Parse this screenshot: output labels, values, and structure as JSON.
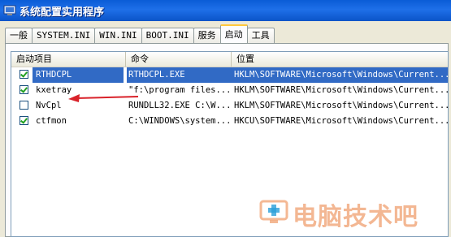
{
  "window": {
    "title": "系统配置实用程序"
  },
  "tabs": [
    {
      "label": "一般"
    },
    {
      "label": "SYSTEM.INI"
    },
    {
      "label": "WIN.INI"
    },
    {
      "label": "BOOT.INI"
    },
    {
      "label": "服务"
    },
    {
      "label": "启动",
      "active": true
    },
    {
      "label": "工具"
    }
  ],
  "list": {
    "columns": [
      "启动项目",
      "命令",
      "位置"
    ],
    "rows": [
      {
        "checked": true,
        "name": "RTHDCPL",
        "command": "RTHDCPL.EXE",
        "location": "HKLM\\SOFTWARE\\Microsoft\\Windows\\Current...",
        "selected": true
      },
      {
        "checked": true,
        "name": "kxetray",
        "command": "\"f:\\program files...",
        "location": "HKLM\\SOFTWARE\\Microsoft\\Windows\\Current..."
      },
      {
        "checked": false,
        "name": "NvCpl",
        "command": "RUNDLL32.EXE C:\\W...",
        "location": "HKLM\\SOFTWARE\\Microsoft\\Windows\\Current..."
      },
      {
        "checked": true,
        "name": "ctfmon",
        "command": "C:\\WINDOWS\\system...",
        "location": "HKCU\\SOFTWARE\\Microsoft\\Windows\\Current..."
      }
    ]
  },
  "watermark": {
    "text": "电脑技术吧",
    "icon": "monitor-plus-icon"
  },
  "colors": {
    "selection": "#316ac5",
    "arrow": "#d9222a",
    "titlebar": "#0a5cd6"
  }
}
